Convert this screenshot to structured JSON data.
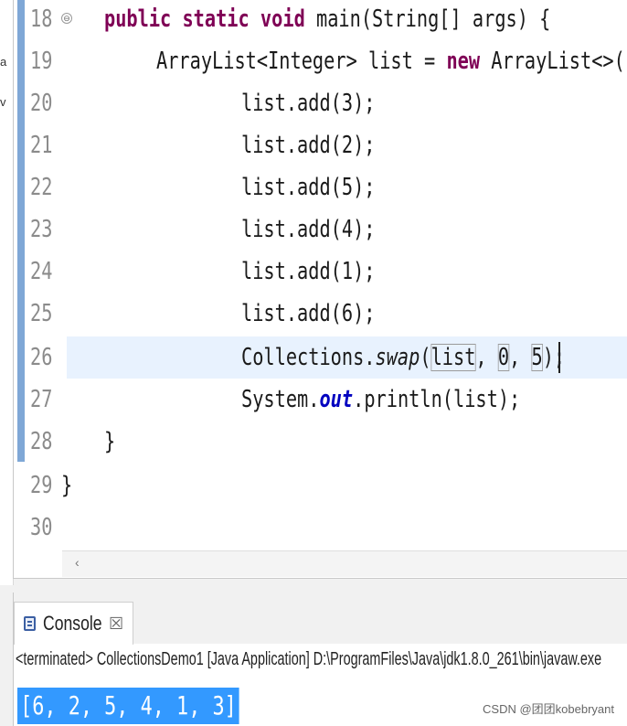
{
  "left_strip": {
    "frag_a": "a",
    "frag_v": "v"
  },
  "editor": {
    "lines": [
      {
        "num": "18",
        "text": ""
      },
      {
        "num": "19",
        "text": ""
      },
      {
        "num": "20",
        "text": "list.add(3);"
      },
      {
        "num": "21",
        "text": "list.add(2);"
      },
      {
        "num": "22",
        "text": "list.add(5);"
      },
      {
        "num": "23",
        "text": "list.add(4);"
      },
      {
        "num": "24",
        "text": "list.add(1);"
      },
      {
        "num": "25",
        "text": "list.add(6);"
      },
      {
        "num": "26",
        "text": ""
      },
      {
        "num": "27",
        "text": ""
      },
      {
        "num": "28",
        "text": "}"
      },
      {
        "num": "29",
        "text": "}"
      },
      {
        "num": "30",
        "text": ""
      }
    ],
    "line18": {
      "kw": "public static void",
      "rest": " main(String[] args) {"
    },
    "line19": {
      "a": "ArrayList<Integer> list = ",
      "kw": "new",
      "b": " ArrayList<>();"
    },
    "line26": {
      "a": "Collections.",
      "method": "swap",
      "b": "(",
      "arg1": "list",
      "c": ", ",
      "arg2": "0",
      "d": ", ",
      "arg3": "5",
      "e": ");"
    },
    "line27": {
      "a": "System.",
      "field": "out",
      "b": ".println(list);"
    },
    "fold_marker": "⊖",
    "scroll_left_arrow": "‹"
  },
  "console": {
    "tab_label": "Console",
    "tab_close": "☒",
    "status": "<terminated> CollectionsDemo1 [Java Application] D:\\ProgramFiles\\Java\\jdk1.8.0_261\\bin\\javaw.exe",
    "output": "[6, 2, 5, 4, 1, 3]"
  },
  "watermark": "CSDN @团团kobebryant"
}
